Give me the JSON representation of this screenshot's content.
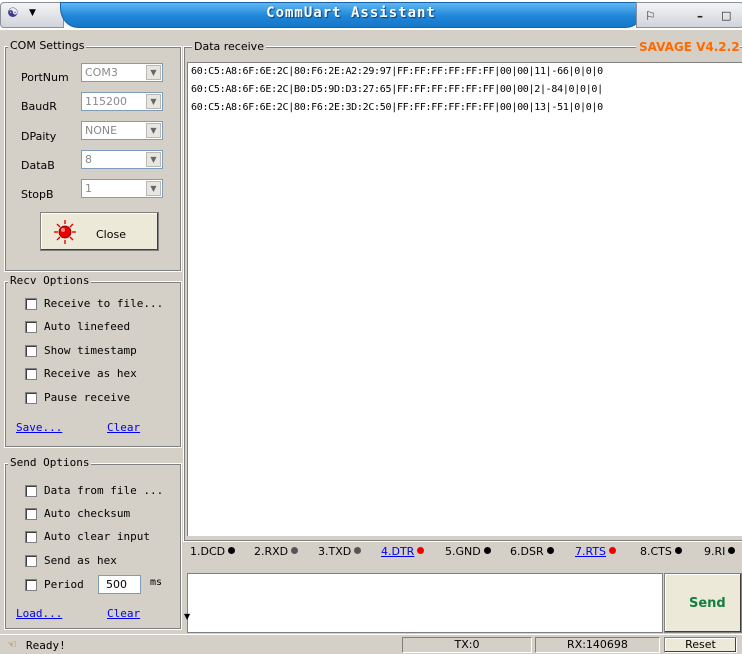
{
  "window": {
    "title": "CommUart Assistant"
  },
  "com_settings": {
    "title": "COM Settings",
    "fields": [
      {
        "label": "PortNum",
        "value": "COM3"
      },
      {
        "label": "BaudR",
        "value": "115200"
      },
      {
        "label": "DPaity",
        "value": "NONE"
      },
      {
        "label": "DataB",
        "value": "8"
      },
      {
        "label": "StopB",
        "value": "1"
      }
    ],
    "close_label": "Close"
  },
  "recv_options": {
    "title": "Recv Options",
    "items": [
      "Receive to file...",
      "Auto linefeed",
      "Show timestamp",
      "Receive as hex",
      "Pause receive"
    ],
    "save_link": "Save...",
    "clear_link": "Clear"
  },
  "send_options": {
    "title": "Send Options",
    "items": [
      "Data from file ...",
      "Auto checksum",
      "Auto clear input",
      "Send as hex"
    ],
    "period_label": "Period",
    "period_value": "500",
    "period_unit": "ms",
    "load_link": "Load...",
    "clear_link": "Clear"
  },
  "receive": {
    "title": "Data receive",
    "version": "SAVAGE V4.2.2",
    "lines": [
      "60:C5:A8:6F:6E:2C|80:F6:2E:A2:29:97|FF:FF:FF:FF:FF:FF|00|00|11|-66|0|0|0",
      "60:C5:A8:6F:6E:2C|B0:D5:9D:D3:27:65|FF:FF:FF:FF:FF:FF|00|00|2|-84|0|0|0|",
      "60:C5:A8:6F:6E:2C|80:F6:2E:3D:2C:50|FF:FF:FF:FF:FF:FF|00|00|13|-51|0|0|0"
    ]
  },
  "pins": [
    {
      "label": "1.DCD",
      "color": "#000000"
    },
    {
      "label": "2.RXD",
      "color": "#555555"
    },
    {
      "label": "3.TXD",
      "color": "#555555"
    },
    {
      "label": "4.DTR",
      "color": "#ee0000"
    },
    {
      "label": "5.GND",
      "color": "#000000"
    },
    {
      "label": "6.DSR",
      "color": "#000000"
    },
    {
      "label": "7.RTS",
      "color": "#ee0000"
    },
    {
      "label": "8.CTS",
      "color": "#000000"
    },
    {
      "label": "9.RI",
      "color": "#000000"
    }
  ],
  "send": {
    "button_label": "Send"
  },
  "status": {
    "ready": "Ready!",
    "tx": "TX:0",
    "rx": "RX:140698",
    "reset_label": "Reset"
  }
}
